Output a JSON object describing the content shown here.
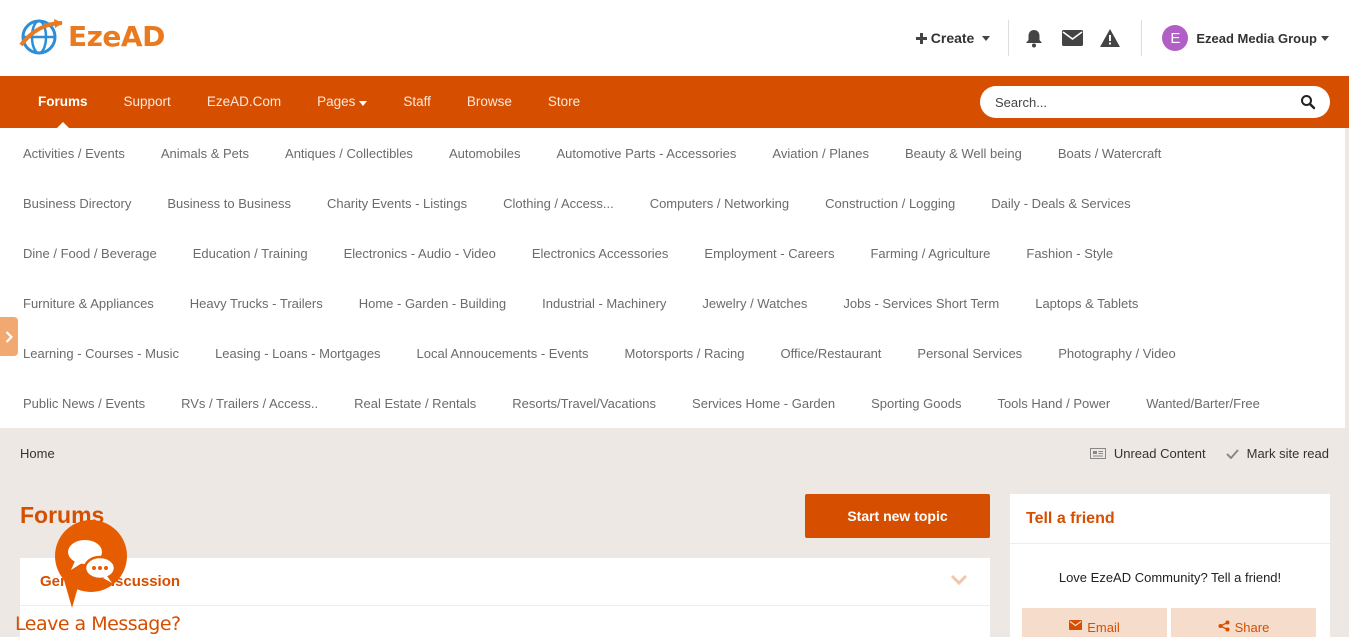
{
  "header": {
    "logo_text": "EzeAD",
    "create_label": "Create",
    "user_initial": "E",
    "user_name": "Ezead Media Group"
  },
  "nav": {
    "items": [
      "Forums",
      "Support",
      "EzeAD.Com",
      "Pages",
      "Staff",
      "Browse",
      "Store"
    ],
    "active": "Forums",
    "search_placeholder": "Search..."
  },
  "categories": [
    [
      "Activities / Events",
      "Animals & Pets",
      "Antiques / Collectibles",
      "Automobiles",
      "Automotive Parts - Accessories",
      "Aviation / Planes",
      "Beauty & Well being",
      "Boats / Watercraft"
    ],
    [
      "Business Directory",
      "Business to Business",
      "Charity Events - Listings",
      "Clothing / Access...",
      "Computers / Networking",
      "Construction / Logging",
      "Daily - Deals & Services"
    ],
    [
      "Dine / Food / Beverage",
      "Education / Training",
      "Electronics - Audio - Video",
      "Electronics Accessories",
      "Employment - Careers",
      "Farming / Agriculture",
      "Fashion - Style"
    ],
    [
      "Furniture & Appliances",
      "Heavy Trucks - Trailers",
      "Home - Garden - Building",
      "Industrial - Machinery",
      "Jewelry / Watches",
      "Jobs - Services Short Term",
      "Laptops & Tablets"
    ],
    [
      "Learning - Courses - Music",
      "Leasing - Loans - Mortgages",
      "Local Annoucements - Events",
      "Motorsports / Racing",
      "Office/Restaurant",
      "Personal Services",
      "Photography / Video"
    ],
    [
      "Public News / Events",
      "RVs / Trailers / Access..",
      "Real Estate / Rentals",
      "Resorts/Travel/Vacations",
      "Services Home - Garden",
      "Sporting Goods",
      "Tools Hand / Power",
      "Wanted/Barter/Free"
    ]
  ],
  "breadcrumb": {
    "home": "Home",
    "unread": "Unread Content",
    "mark_read": "Mark site read"
  },
  "main": {
    "title": "Forums",
    "start_topic": "Start new topic",
    "section_title": "General Discussion"
  },
  "widget": {
    "title": "Tell a friend",
    "text": "Love EzeAD Community? Tell a friend!",
    "email": "Email",
    "share": "Share"
  },
  "chat": {
    "label": "Leave a Message?"
  },
  "colors": {
    "brand": "#d64f00",
    "page_bg": "#ede8e4"
  }
}
